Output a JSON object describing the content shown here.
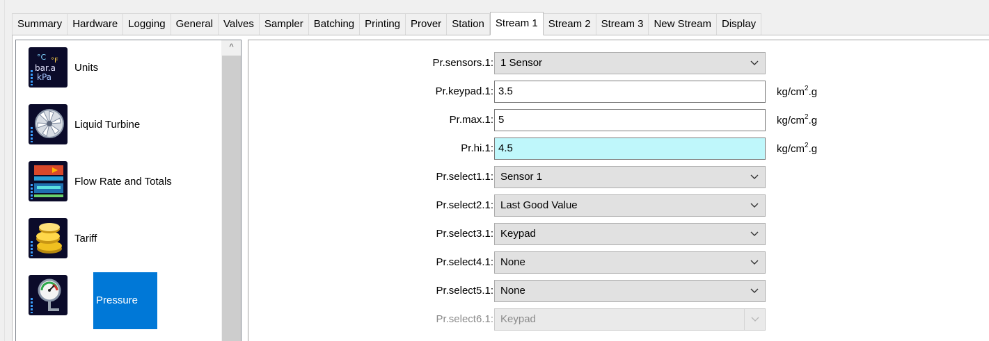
{
  "tabs": [
    {
      "label": "Summary",
      "active": false
    },
    {
      "label": "Hardware",
      "active": false
    },
    {
      "label": "Logging",
      "active": false
    },
    {
      "label": "General",
      "active": false
    },
    {
      "label": "Valves",
      "active": false
    },
    {
      "label": "Sampler",
      "active": false
    },
    {
      "label": "Batching",
      "active": false
    },
    {
      "label": "Printing",
      "active": false
    },
    {
      "label": "Prover",
      "active": false
    },
    {
      "label": "Station",
      "active": false
    },
    {
      "label": "Stream 1",
      "active": true
    },
    {
      "label": "Stream 2",
      "active": false
    },
    {
      "label": "Stream 3",
      "active": false
    },
    {
      "label": "New Stream",
      "active": false
    },
    {
      "label": "Display",
      "active": false
    }
  ],
  "sidebar": {
    "items": [
      {
        "label": "Units",
        "icon": "units-icon",
        "icon_text": "°C °F bar.a kPa",
        "selected": false
      },
      {
        "label": "Liquid Turbine",
        "icon": "turbine-icon",
        "selected": false
      },
      {
        "label": "Flow Rate and Totals",
        "icon": "flow-rate-icon",
        "selected": false
      },
      {
        "label": "Tariff",
        "icon": "coins-icon",
        "selected": false
      },
      {
        "label": "Pressure",
        "icon": "pressure-gauge-icon",
        "selected": true
      }
    ],
    "scroll_up": "^"
  },
  "form": {
    "rows": [
      {
        "label": "Pr.sensors.1:",
        "type": "select",
        "value": "1 Sensor"
      },
      {
        "label": "Pr.keypad.1:",
        "type": "input",
        "value": "3.5",
        "unit_base": "kg/cm",
        "unit_sup": "2",
        "unit_tail": ".g"
      },
      {
        "label": "Pr.max.1:",
        "type": "input",
        "value": "5",
        "unit_base": "kg/cm",
        "unit_sup": "2",
        "unit_tail": ".g"
      },
      {
        "label": "Pr.hi.1:",
        "type": "input",
        "value": "4.5",
        "highlight": true,
        "unit_base": "kg/cm",
        "unit_sup": "2",
        "unit_tail": ".g"
      },
      {
        "label": "Pr.select1.1:",
        "type": "select",
        "value": "Sensor 1"
      },
      {
        "label": "Pr.select2.1:",
        "type": "select",
        "value": "Last Good Value"
      },
      {
        "label": "Pr.select3.1:",
        "type": "select",
        "value": "Keypad"
      },
      {
        "label": "Pr.select4.1:",
        "type": "select",
        "value": "None"
      },
      {
        "label": "Pr.select5.1:",
        "type": "select",
        "value": "None"
      },
      {
        "label": "Pr.select6.1:",
        "type": "select",
        "value": "Keypad",
        "disabled": true
      }
    ]
  },
  "colors": {
    "selection": "#0078d7",
    "highlight_input": "#bff7fb",
    "icon_bg": "#0b0b2a"
  }
}
